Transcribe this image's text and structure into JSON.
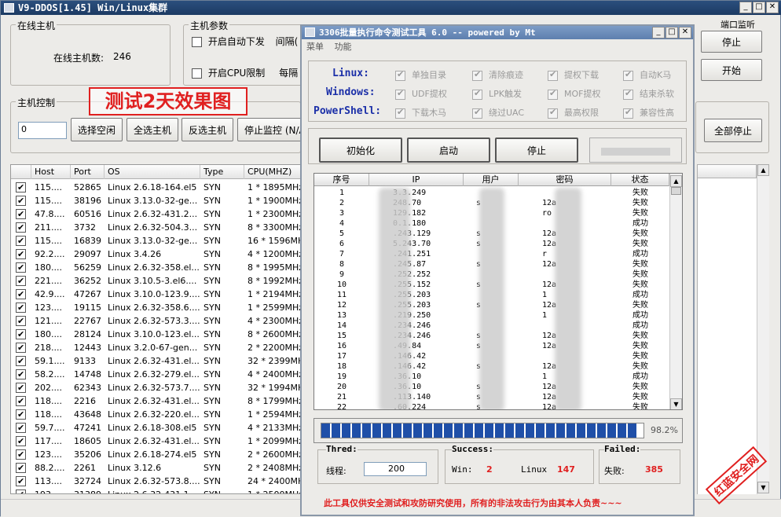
{
  "main_window": {
    "title": "V9-DDOS[1.45] Win/Linux集群",
    "online": {
      "group_title": "在线主机",
      "count_label": "在线主机数:",
      "count": "246"
    },
    "params": {
      "group_title": "主机参数",
      "auto_deliver": "开启自动下发",
      "interval": "间隔(",
      "cpu_limit": "开启CPU限制",
      "every": "每隔"
    },
    "port_label": "端口监听",
    "control": {
      "group_title": "主机控制",
      "input_value": "0",
      "select_idle": "选择空闲",
      "select_all": "全选主机",
      "invert": "反选主机",
      "stop_monitor": "停止监控 (N/A",
      "stop_all": "全部停止"
    },
    "stop": "停止",
    "start": "开始",
    "columns": [
      "Host",
      "Port",
      "OS",
      "Type",
      "CPU(MHZ)"
    ],
    "rows": [
      [
        "115....",
        "52865",
        "Linux 2.6.18-164.el5",
        "SYN",
        "1 * 1895MHz"
      ],
      [
        "115....",
        "38196",
        "Linux 3.13.0-32-ge...",
        "SYN",
        "1 * 1900MHz"
      ],
      [
        "47.8....",
        "60516",
        "Linux 2.6.32-431.2...",
        "SYN",
        "1 * 2300MHz"
      ],
      [
        "211....",
        "3732",
        "Linux 2.6.32-504.3...",
        "SYN",
        "8 * 3300MHz"
      ],
      [
        "115....",
        "16839",
        "Linux 3.13.0-32-ge...",
        "SYN",
        "16 * 1596MHz"
      ],
      [
        "92.2....",
        "29097",
        "Linux 3.4.26",
        "SYN",
        "4 * 1200MHz"
      ],
      [
        "180....",
        "56259",
        "Linux 2.6.32-358.el...",
        "SYN",
        "8 * 1995MHz"
      ],
      [
        "221....",
        "36252",
        "Linux 3.10.5-3.el6....",
        "SYN",
        "8 * 1992MHz"
      ],
      [
        "42.9....",
        "47267",
        "Linux 3.10.0-123.9....",
        "SYN",
        "1 * 2194MHz"
      ],
      [
        "123....",
        "19115",
        "Linux 2.6.32-358.6....",
        "SYN",
        "1 * 2599MHz"
      ],
      [
        "121....",
        "22767",
        "Linux 2.6.32-573.3....",
        "SYN",
        "4 * 2300MHz"
      ],
      [
        "180....",
        "28124",
        "Linux 3.10.0-123.el...",
        "SYN",
        "8 * 2600MHz"
      ],
      [
        "218....",
        "12443",
        "Linux 3.2.0-67-gen...",
        "SYN",
        "2 * 2200MHz"
      ],
      [
        "59.1....",
        "9133",
        "Linux 2.6.32-431.el...",
        "SYN",
        "32 * 2399MHz"
      ],
      [
        "58.2....",
        "14748",
        "Linux 2.6.32-279.el...",
        "SYN",
        "4 * 2400MHz"
      ],
      [
        "202....",
        "62343",
        "Linux 2.6.32-573.7....",
        "SYN",
        "32 * 1994MHz"
      ],
      [
        "118....",
        "2216",
        "Linux 2.6.32-431.el...",
        "SYN",
        "8 * 1799MHz"
      ],
      [
        "118....",
        "43648",
        "Linux 2.6.32-220.el...",
        "SYN",
        "1 * 2594MHz"
      ],
      [
        "59.7....",
        "47241",
        "Linux 2.6.18-308.el5",
        "SYN",
        "4 * 2133MHz"
      ],
      [
        "117....",
        "18605",
        "Linux 2.6.32-431.el...",
        "SYN",
        "1 * 2099MHz"
      ],
      [
        "123....",
        "35206",
        "Linux 2.6.18-274.el5",
        "SYN",
        "2 * 2600MHz"
      ],
      [
        "88.2....",
        "2261",
        "Linux 3.12.6",
        "SYN",
        "2 * 2408MHz"
      ],
      [
        "113....",
        "32724",
        "Linux 2.6.32-573.8....",
        "SYN",
        "24 * 2400MHz"
      ],
      [
        "193",
        "31389",
        "Linux 2.6.32-431.1",
        "SYN",
        "1 * 2500MHz"
      ]
    ]
  },
  "overlay_caption": "测试2天效果图",
  "tool_window": {
    "title": "3306批量执行命令测试工具 6.0 -- powered by Mt",
    "menu": [
      "菜单",
      "功能"
    ],
    "platforms": [
      "Linux:",
      "Windows:",
      "PowerShell:"
    ],
    "options": [
      [
        "单独目录",
        "清除痕迹",
        "提权下载",
        "自动K马"
      ],
      [
        "UDF提权",
        "LPK触发",
        "MOF提权",
        "结束杀软"
      ],
      [
        "下载木马",
        "绕过UAC",
        "最高权限",
        "兼容性高"
      ]
    ],
    "init": "初始化",
    "launch": "启动",
    "stop": "停止",
    "columns": [
      "序号",
      "IP",
      "用户",
      "密码",
      "状态"
    ],
    "rows": [
      [
        "1",
        "3.3.249",
        "",
        "",
        "失败"
      ],
      [
        "2",
        "248.70",
        "s",
        "12a",
        "失败"
      ],
      [
        "3",
        "129.182",
        "",
        "ro",
        "失败"
      ],
      [
        "4",
        "0.1.180",
        "",
        "",
        "成功"
      ],
      [
        "5",
        ".243.129",
        "s",
        "12a",
        "失败"
      ],
      [
        "6",
        "5.243.70",
        "s",
        "12a",
        "失败"
      ],
      [
        "7",
        ".241.251",
        "",
        "r",
        "成功"
      ],
      [
        "8",
        ".245.87",
        "s",
        "12a",
        "失败"
      ],
      [
        "9",
        ".252.252",
        "",
        "",
        "失败"
      ],
      [
        "10",
        ".255.152",
        "s",
        "12a",
        "失败"
      ],
      [
        "11",
        ".255.203",
        "",
        "1",
        "成功"
      ],
      [
        "12",
        ".255.203",
        "s",
        "12a",
        "失败"
      ],
      [
        "13",
        ".219.250",
        "",
        "1",
        "成功"
      ],
      [
        "14",
        ".234.246",
        "",
        "",
        "成功"
      ],
      [
        "15",
        ".234.246",
        "s",
        "12a",
        "失败"
      ],
      [
        "16",
        ".49.84",
        "s",
        "12a",
        "失败"
      ],
      [
        "17",
        ".146.42",
        "",
        "",
        "失败"
      ],
      [
        "18",
        ".146.42",
        "s",
        "12a",
        "失败"
      ],
      [
        "19",
        ".36.10",
        "",
        "1",
        "成功"
      ],
      [
        "20",
        ".36.10",
        "s",
        "12a",
        "失败"
      ],
      [
        "21",
        ".113.140",
        "s",
        "12a",
        "失败"
      ],
      [
        "22",
        ".60.224",
        "s",
        "12a",
        "失败"
      ]
    ],
    "progress": {
      "value": 0.982,
      "label": "98.2%"
    },
    "thread": {
      "title": "Thred:",
      "label": "线程:",
      "value": "200"
    },
    "success": {
      "title": "Success:",
      "win_label": "Win:",
      "win_value": "2",
      "linux_label": "Linux",
      "linux_value": "147"
    },
    "failed": {
      "title": "Failed:",
      "label": "失败:",
      "value": "385"
    },
    "disclaimer": "此工具仅供安全测试和攻防研究使用，所有的非法攻击行为由其本人负责~~~"
  },
  "watermark": "红蓝安全网",
  "colors": {
    "progress": "#1f4fa8",
    "accent_red": "#e02020",
    "label_blue": "#1b2fa8"
  }
}
